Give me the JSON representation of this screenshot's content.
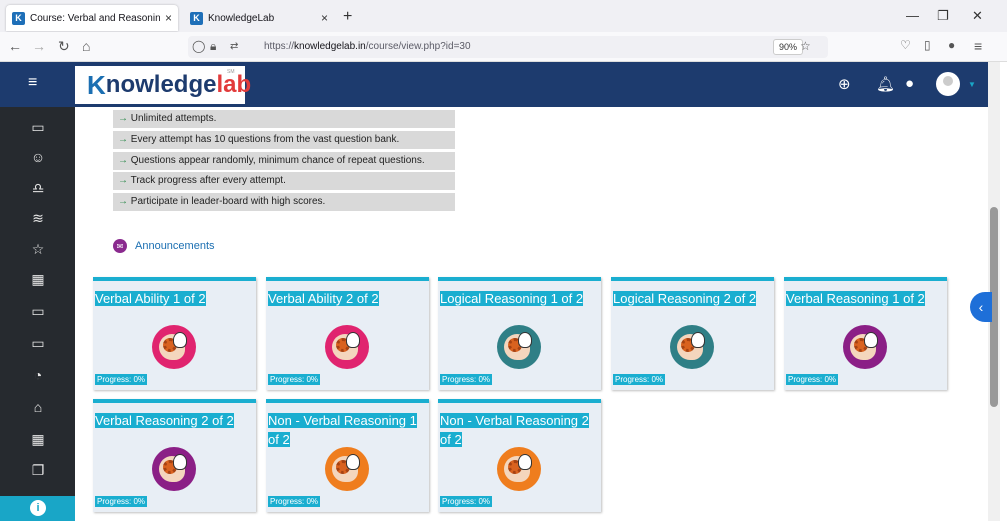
{
  "browser": {
    "tabs": [
      {
        "title": "Course: Verbal and Reasoning P",
        "active": true
      },
      {
        "title": "KnowledgeLab",
        "active": false
      }
    ],
    "favicon_letter": "K",
    "url_prefix": "https://",
    "url_domain": "knowledgelab.in",
    "url_path": "/course/view.php?id=30",
    "zoom": "90%"
  },
  "header": {
    "logo_first": "K",
    "logo_middle": "nowledge",
    "logo_last": "lab",
    "logo_sm": "SM"
  },
  "features": [
    "Unlimited attempts.",
    "Every attempt has 10 questions from the vast question bank.",
    "Questions appear randomly, minimum chance of repeat questions.",
    "Track progress after every attempt.",
    "Participate in leader-board with high scores."
  ],
  "feature_arrow": "→",
  "announcements": "Announcements",
  "cards": [
    {
      "title": "Verbal Ability 1 of 2",
      "progress": "Progress: 0%",
      "color": "#e0246f"
    },
    {
      "title": "Verbal Ability 2 of 2",
      "progress": "Progress: 0%",
      "color": "#e0246f"
    },
    {
      "title": "Logical Reasoning 1 of 2",
      "progress": "Progress: 0%",
      "color": "#2f7f86"
    },
    {
      "title": "Logical Reasoning 2 of 2",
      "progress": "Progress: 0%",
      "color": "#2f7f86"
    },
    {
      "title": "Verbal Reasoning 1 of 2",
      "progress": "Progress: 0%",
      "color": "#8b1f86"
    },
    {
      "title": "Verbal Reasoning 2 of 2",
      "progress": "Progress: 0%",
      "color": "#8b1f86"
    },
    {
      "title": "Non - Verbal Reasoning 1 of 2",
      "progress": "Progress: 0%",
      "color": "#ef7d1e"
    },
    {
      "title": "Non - Verbal Reasoning 2 of 2",
      "progress": "Progress: 0%",
      "color": "#ef7d1e"
    }
  ],
  "colors": {
    "header_bg": "#1d3b6e",
    "sidebar_bg": "#262a2f",
    "accent": "#1aaed0"
  }
}
